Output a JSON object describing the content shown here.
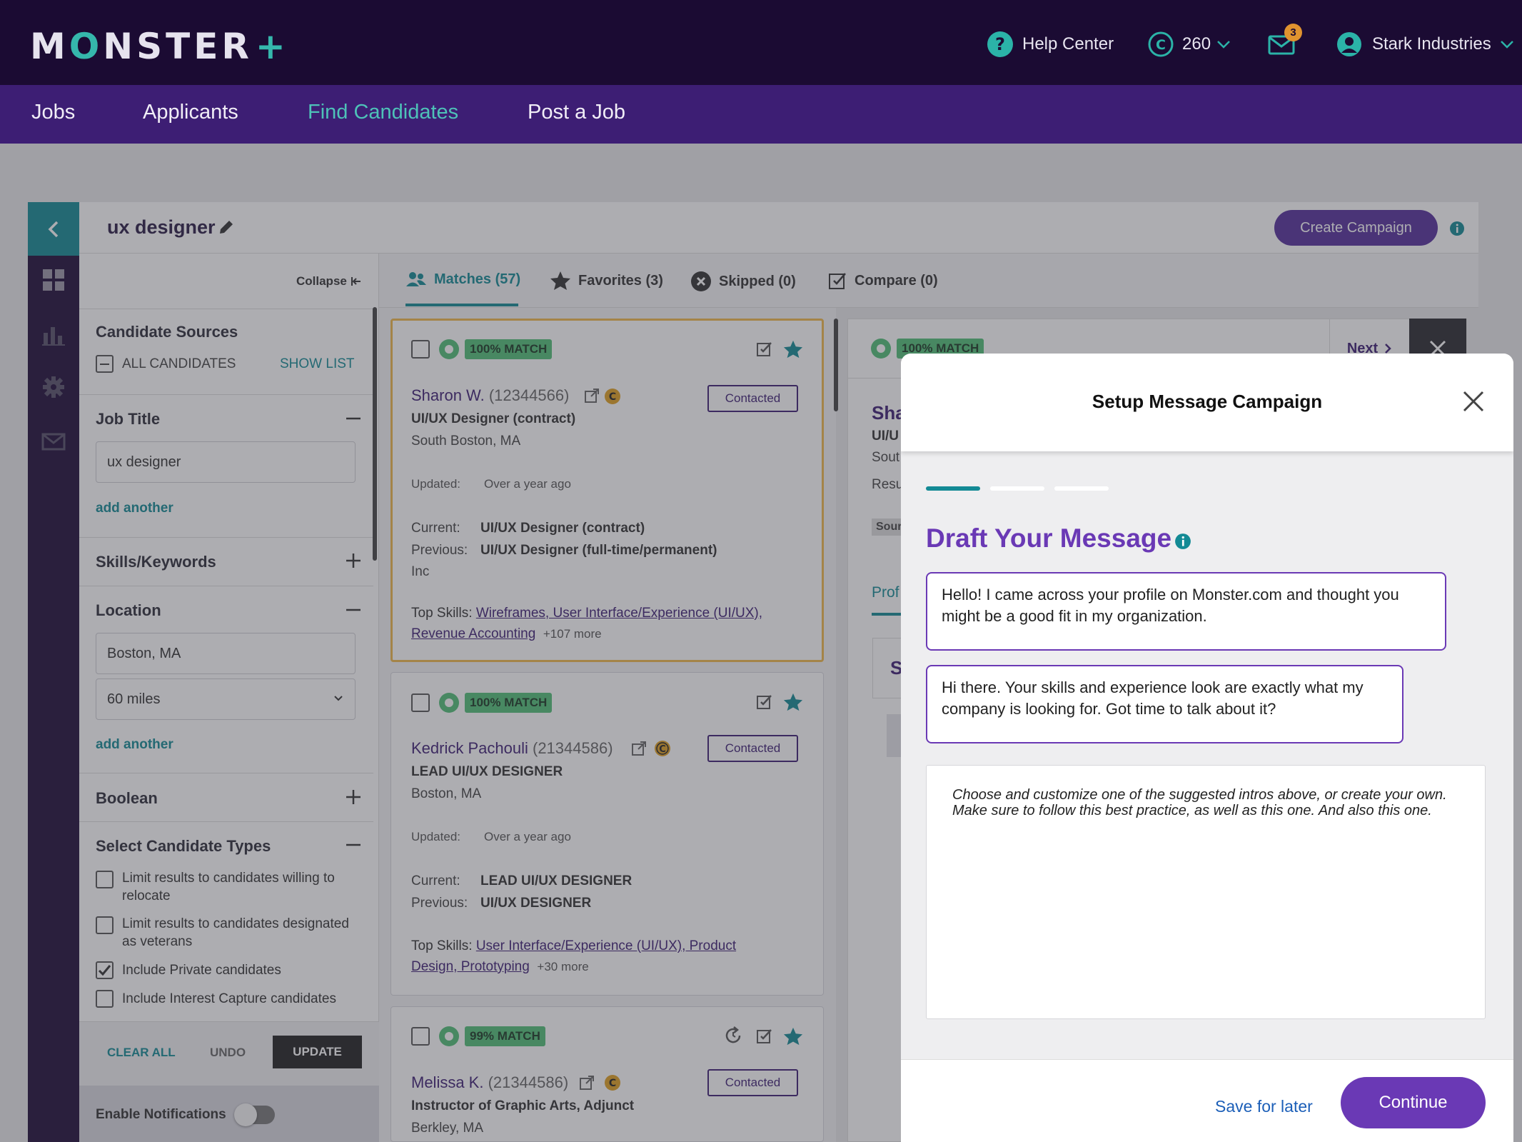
{
  "header": {
    "logo_text_m": "M",
    "logo_text_o": "O",
    "logo_text_rest": "NSTER",
    "logo_plus": "+",
    "help_center": "Help Center",
    "credits": "260",
    "mail_badge": "3",
    "company": "Stark Industries"
  },
  "nav": {
    "jobs": "Jobs",
    "applicants": "Applicants",
    "find_candidates": "Find Candidates",
    "post_job": "Post a Job"
  },
  "search": {
    "title": "ux designer",
    "create_campaign": "Create Campaign"
  },
  "filters": {
    "collapse": "Collapse",
    "candidate_sources": "Candidate Sources",
    "all_candidates": "ALL CANDIDATES",
    "show_list": "SHOW LIST",
    "job_title_label": "Job Title",
    "job_title_value": "ux designer",
    "add_another_1": "add another",
    "skills_label": "Skills/Keywords",
    "location_label": "Location",
    "location_value": "Boston, MA",
    "radius_value": "60 miles",
    "add_another_2": "add another",
    "boolean_label": "Boolean",
    "candidate_types_label": "Select Candidate Types",
    "types": [
      {
        "label": "Limit results to candidates willing to relocate",
        "checked": false
      },
      {
        "label": "Limit results to candidates designated as veterans",
        "checked": false
      },
      {
        "label": "Include Private candidates",
        "checked": true
      },
      {
        "label": "Include Interest Capture candidates",
        "checked": false
      }
    ],
    "clear_all": "CLEAR ALL",
    "undo": "UNDO",
    "update": "UPDATE",
    "enable_notifications": "Enable Notifications"
  },
  "tabs": {
    "matches": "Matches (57)",
    "favorites": "Favorites (3)",
    "skipped": "Skipped (0)",
    "compare": "Compare (0)"
  },
  "candidates": [
    {
      "match": "100% MATCH",
      "name": "Sharon W.",
      "id": "(12344566)",
      "title": "UI/UX Designer (contract)",
      "location": "South Boston, MA",
      "status": "Contacted",
      "updated_label": "Updated:",
      "updated_value": "Over a year ago",
      "current_label": "Current:",
      "current_value": "UI/UX Designer (contract)",
      "previous_label": "Previous:",
      "previous_value": "UI/UX Designer (full-time/permanent)",
      "previous_extra": "Inc",
      "skills_label": "Top Skills:",
      "skills_line1": "Wireframes, User Interface/Experience (UI/UX),",
      "skills_line2": "Revenue Accounting",
      "skills_more": "+107 more"
    },
    {
      "match": "100% MATCH",
      "name": "Kedrick Pachouli",
      "id": "(21344586)",
      "title": "LEAD UI/UX DESIGNER",
      "location": "Boston, MA",
      "status": "Contacted",
      "updated_label": "Updated:",
      "updated_value": "Over a year ago",
      "current_label": "Current:",
      "current_value": "LEAD UI/UX DESIGNER",
      "previous_label": "Previous:",
      "previous_value": "UI/UX DESIGNER",
      "skills_label": "Top Skills:",
      "skills_line1": "User Interface/Experience (UI/UX), Product",
      "skills_line2": "Design, Prototyping",
      "skills_more": "+30 more"
    },
    {
      "match": "99% MATCH",
      "name": "Melissa K.",
      "id": "(21344586)",
      "title": "Instructor of Graphic Arts, Adjunct",
      "location": "Berkley, MA",
      "status": "Contacted"
    }
  ],
  "detail": {
    "match": "100% MATCH",
    "next": "Next",
    "name_partial": "Sha",
    "title_partial": "UI/U",
    "loc_partial": "Sout",
    "resume_partial": "Resu",
    "source_partial": "Sour",
    "profile_partial": "Prof",
    "section_partial": "S"
  },
  "modal": {
    "title": "Setup Message Campaign",
    "draft_title": "Draft Your Message",
    "intro1": "Hello! I came across your profile on Monster.com and thought you might be a good fit in my organization.",
    "intro2": "Hi there. Your skills and experience look are exactly what my company is looking for. Got time to talk about it?",
    "placeholder": "Choose and customize one of the suggested intros above, or create your own. Make sure to follow this best practice, as well as this one. And also this one.",
    "save_later": "Save for later",
    "continue": "Continue",
    "steps_total": 3,
    "steps_active": 1
  },
  "colors": {
    "header_bg": "#1b0b33",
    "nav_bg": "#3d1e74",
    "teal": "#138a95",
    "purple": "#6a39b5",
    "match_green": "#52c077"
  }
}
